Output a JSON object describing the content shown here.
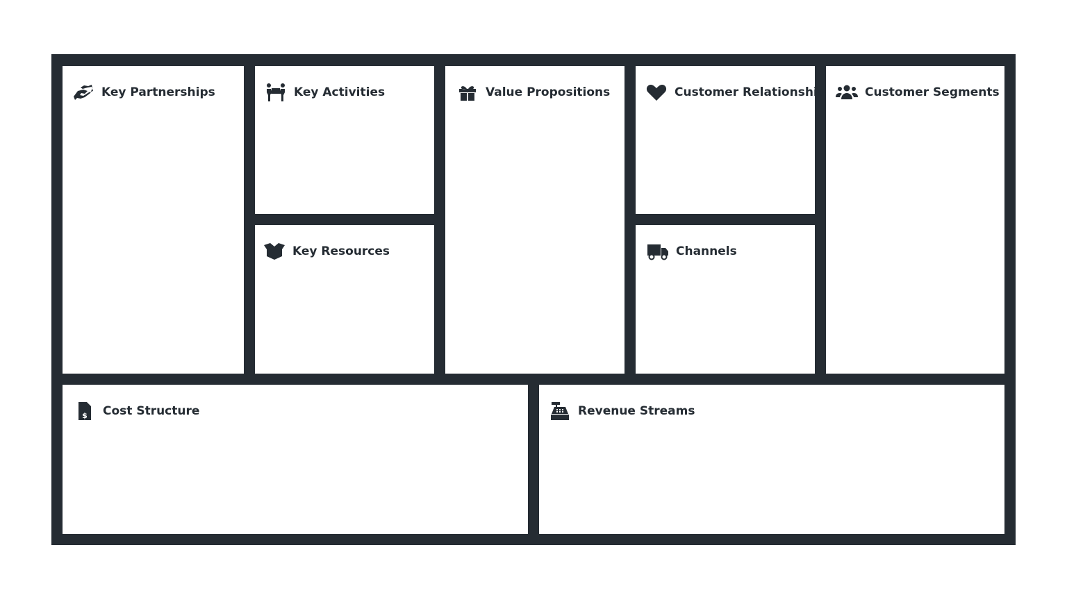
{
  "canvas": {
    "color": "#252c33",
    "blocks": [
      {
        "id": "key-partnerships",
        "title": "Key Partnerships",
        "icon": "handshake-icon"
      },
      {
        "id": "key-activities",
        "title": "Key Activities",
        "icon": "people-carry-icon"
      },
      {
        "id": "key-resources",
        "title": "Key Resources",
        "icon": "open-box-icon"
      },
      {
        "id": "value-propositions",
        "title": "Value Propositions",
        "icon": "gift-icon"
      },
      {
        "id": "customer-relationships",
        "title": "Customer Relationships",
        "icon": "heart-icon"
      },
      {
        "id": "channels",
        "title": "Channels",
        "icon": "truck-icon"
      },
      {
        "id": "customer-segments",
        "title": "Customer Segments",
        "icon": "users-icon"
      },
      {
        "id": "cost-structure",
        "title": "Cost Structure",
        "icon": "invoice-dollar-icon"
      },
      {
        "id": "revenue-streams",
        "title": "Revenue Streams",
        "icon": "cash-register-icon"
      }
    ]
  }
}
